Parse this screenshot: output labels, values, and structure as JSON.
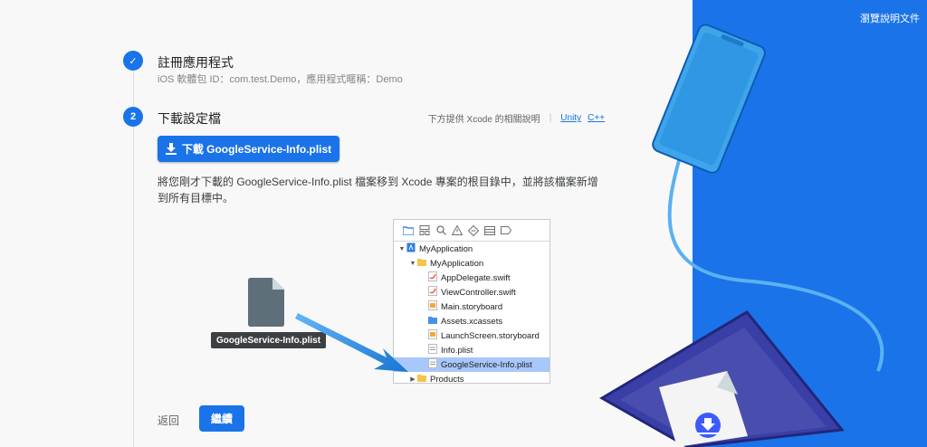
{
  "step1": {
    "number": "✓",
    "title": "註冊應用程式",
    "subtitle": "iOS 軟體包 ID：com.test.Demo，應用程式暱稱：Demo"
  },
  "step2": {
    "number": "2",
    "title": "下載設定檔",
    "help_text": "下方提供 Xcode 的相關說明",
    "help_separator": "|",
    "links": [
      "Unity",
      "C++"
    ],
    "download_button": "下載 GoogleService-Info.plist",
    "description": "將您剛才下載的 GoogleService-Info.plist 檔案移到 Xcode 專案的根目錄中，並將該檔案新增到所有目標中。"
  },
  "xcode": {
    "toolbar_icons": [
      "folder-icon",
      "hierarchy-icon",
      "search-icon",
      "warning-icon",
      "diamond-icon",
      "list-icon",
      "tag-icon"
    ],
    "tree": [
      {
        "label": "MyApplication",
        "indent": 0,
        "expanded": true,
        "icon": "project"
      },
      {
        "label": "MyApplication",
        "indent": 1,
        "expanded": true,
        "icon": "folder"
      },
      {
        "label": "AppDelegate.swift",
        "indent": 2,
        "icon": "swift"
      },
      {
        "label": "ViewController.swift",
        "indent": 2,
        "icon": "swift"
      },
      {
        "label": "Main.storyboard",
        "indent": 2,
        "icon": "storyboard"
      },
      {
        "label": "Assets.xcassets",
        "indent": 2,
        "icon": "assets"
      },
      {
        "label": "LaunchScreen.storyboard",
        "indent": 2,
        "icon": "storyboard"
      },
      {
        "label": "Info.plist",
        "indent": 2,
        "icon": "plist"
      },
      {
        "label": "GoogleService-Info.plist",
        "indent": 2,
        "icon": "plist",
        "selected": true
      },
      {
        "label": "Products",
        "indent": 1,
        "expanded": false,
        "icon": "folder"
      }
    ]
  },
  "file_label": "GoogleService-Info.plist",
  "footer": {
    "back": "返回",
    "continue": "繼續"
  },
  "docs_link": "瀏覽說明文件",
  "colors": {
    "primary": "#1a73e8",
    "selection": "#a8c7fa",
    "tooltip": "#3c4043"
  }
}
